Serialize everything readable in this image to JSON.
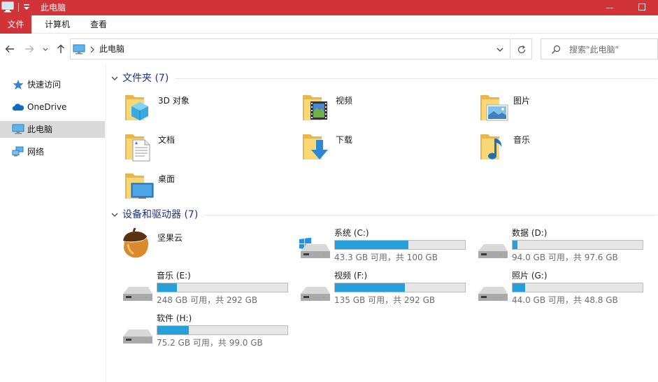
{
  "window": {
    "title": "此电脑"
  },
  "ribbon": {
    "tabs": [
      "文件",
      "计算机",
      "查看"
    ]
  },
  "address": {
    "path": "此电脑"
  },
  "search": {
    "placeholder": "搜索\"此电脑\""
  },
  "sidebar": {
    "items": [
      {
        "label": "快速访问",
        "icon": "star-icon"
      },
      {
        "label": "OneDrive",
        "icon": "cloud-icon"
      },
      {
        "label": "此电脑",
        "icon": "computer-icon",
        "selected": true
      },
      {
        "label": "网络",
        "icon": "network-icon"
      }
    ]
  },
  "folders": {
    "title": "文件夹 (7)",
    "items": [
      {
        "label": "3D 对象",
        "icon": "3d-objects-folder-icon"
      },
      {
        "label": "视频",
        "icon": "videos-folder-icon"
      },
      {
        "label": "图片",
        "icon": "pictures-folder-icon"
      },
      {
        "label": "文档",
        "icon": "documents-folder-icon"
      },
      {
        "label": "下载",
        "icon": "downloads-folder-icon"
      },
      {
        "label": "音乐",
        "icon": "music-folder-icon"
      },
      {
        "label": "桌面",
        "icon": "desktop-folder-icon"
      }
    ]
  },
  "devices": {
    "title": "设备和驱动器 (7)",
    "app": {
      "label": "坚果云",
      "icon": "nutstore-icon"
    },
    "drives": [
      {
        "label": "系统 (C:)",
        "free": "43.3 GB 可用，共 100 GB",
        "used_fraction": 0.567,
        "system": true
      },
      {
        "label": "数据 (D:)",
        "free": "94.0 GB 可用，共 97.6 GB",
        "used_fraction": 0.037
      },
      {
        "label": "音乐 (E:)",
        "free": "248 GB 可用，共 292 GB",
        "used_fraction": 0.151
      },
      {
        "label": "视频 (F:)",
        "free": "135 GB 可用，共 292 GB",
        "used_fraction": 0.538
      },
      {
        "label": "照片 (G:)",
        "free": "44.0 GB 可用，共 48.8 GB",
        "used_fraction": 0.098
      },
      {
        "label": "软件 (H:)",
        "free": "75.2 GB 可用，共 99.0 GB",
        "used_fraction": 0.24
      }
    ]
  },
  "colors": {
    "accent": "#d13438",
    "progress": "#26a0da",
    "group_title": "#1e3287",
    "folder": "#f8d775"
  }
}
